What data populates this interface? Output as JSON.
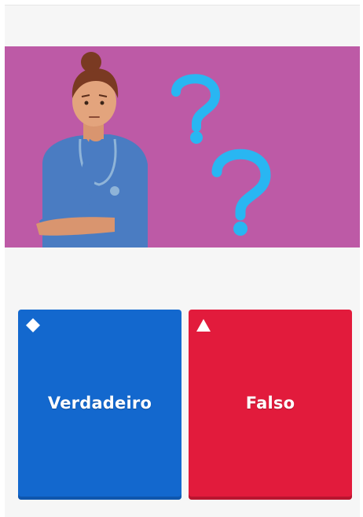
{
  "question": {
    "image_alt": "illustration-nurse-thinking-question-marks",
    "background_color": "#bd5aa6",
    "question_mark_color": "#29b6f2"
  },
  "answers": [
    {
      "label": "Verdadeiro",
      "shape": "diamond-icon",
      "color": "#1368ce"
    },
    {
      "label": "Falso",
      "shape": "triangle-icon",
      "color": "#e21b3c"
    }
  ]
}
